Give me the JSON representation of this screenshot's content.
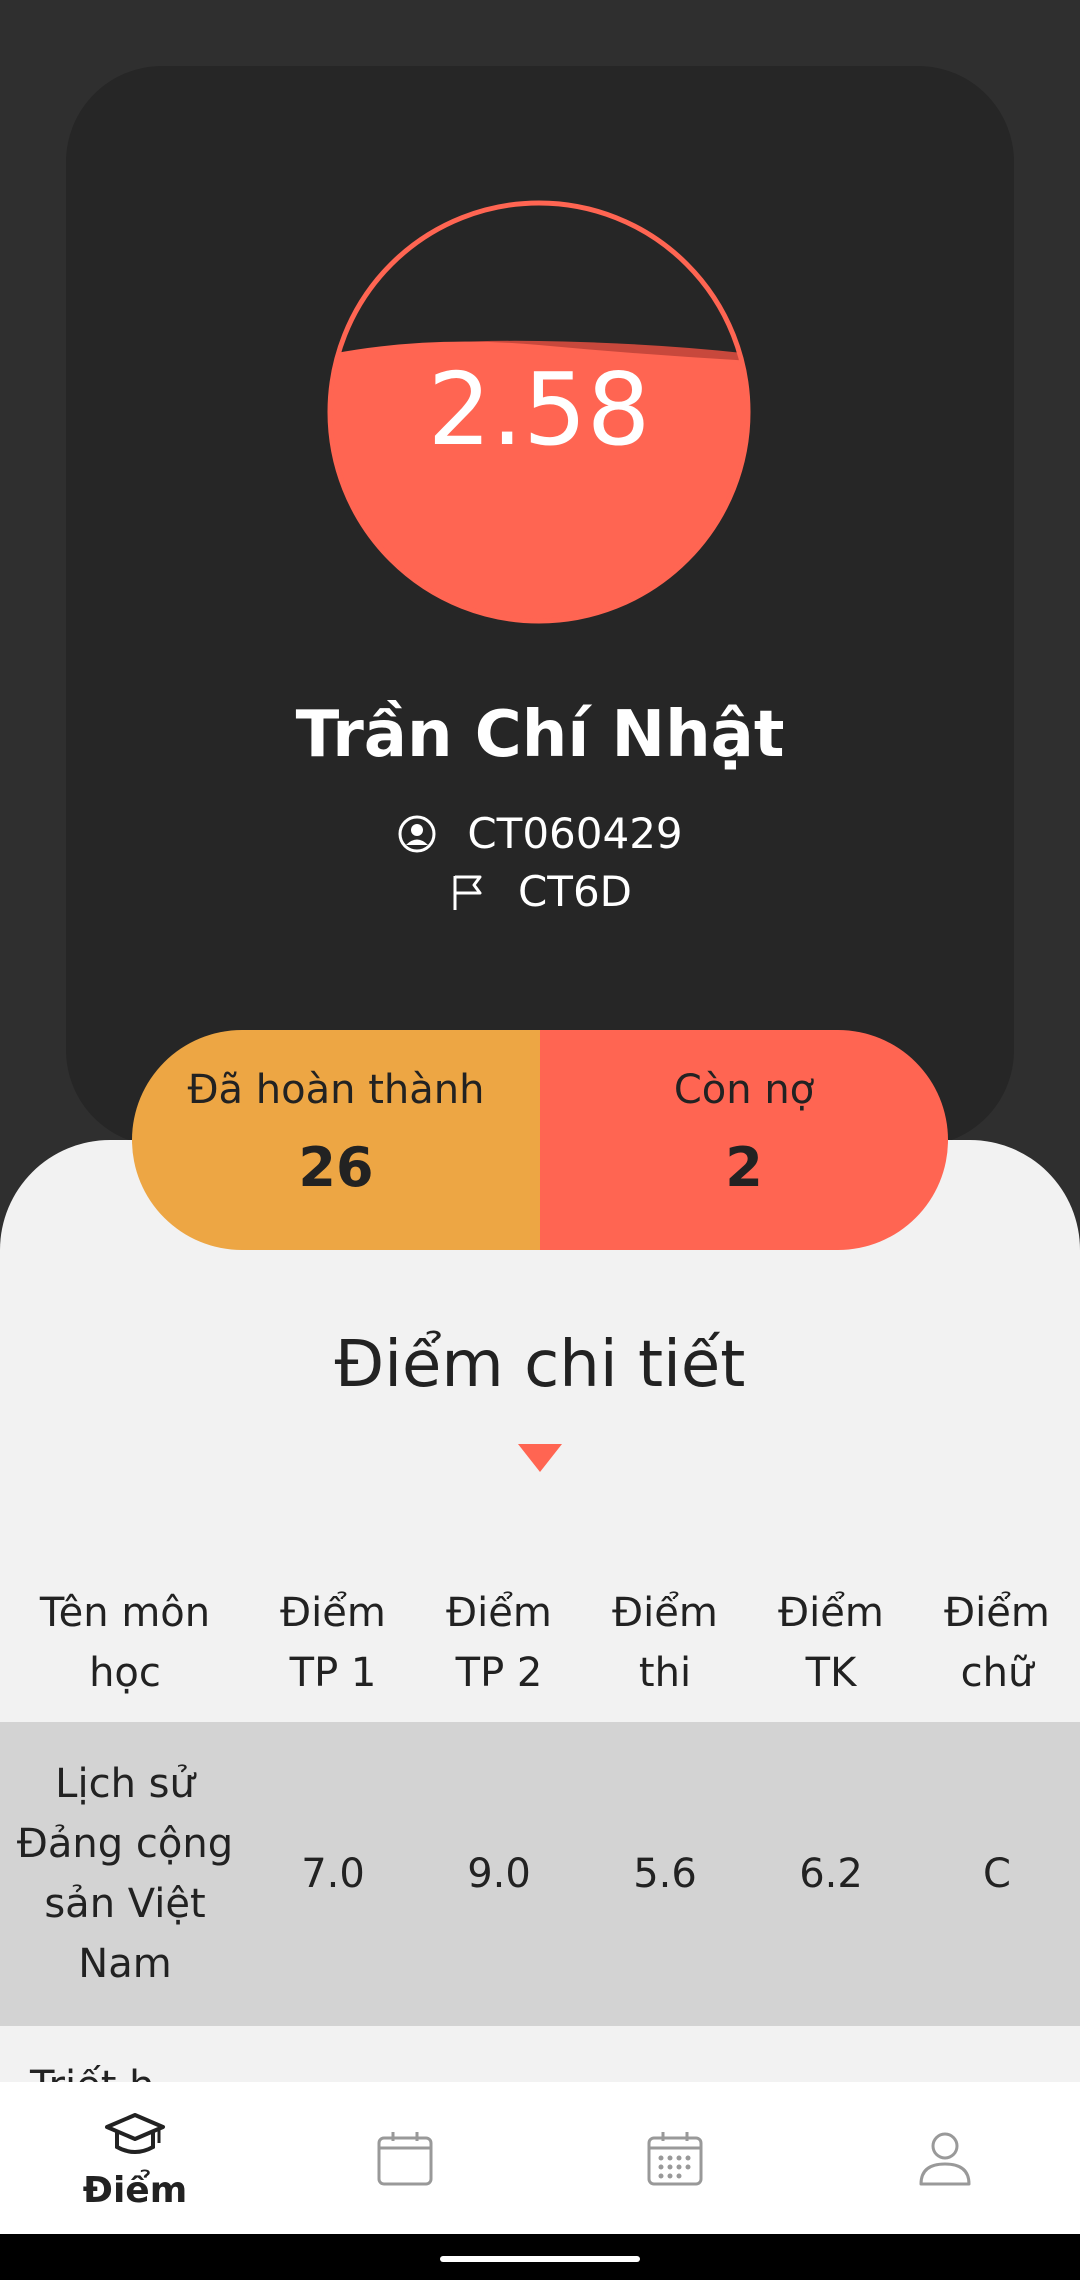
{
  "header": {
    "gpa": "2.58",
    "gpa_fill_percent": 65,
    "student_name": "Trần Chí Nhật",
    "student_id": "CT060429",
    "class_name": "CT6D"
  },
  "stats": {
    "completed_label": "Đã hoàn thành",
    "completed_value": "26",
    "debt_label": "Còn nợ",
    "debt_value": "2"
  },
  "section": {
    "title": "Điểm chi tiết"
  },
  "table": {
    "headers": [
      "Tên môn học",
      "Điểm TP 1",
      "Điểm TP 2",
      "Điểm thi",
      "Điểm TK",
      "Điểm chữ"
    ],
    "rows": [
      [
        "Lịch sử Đảng cộng sản Việt Nam",
        "7.0",
        "9.0",
        "5.6",
        "6.2",
        "C"
      ]
    ],
    "next_row_partial": "Triết h"
  },
  "nav": {
    "items": [
      {
        "label": "Điểm",
        "icon": "graduation-cap-icon",
        "active": true
      },
      {
        "label": "",
        "icon": "calendar-blank-icon",
        "active": false
      },
      {
        "label": "",
        "icon": "calendar-grid-icon",
        "active": false
      },
      {
        "label": "",
        "icon": "user-icon",
        "active": false
      }
    ]
  },
  "colors": {
    "accent_red": "#ff6552",
    "accent_orange": "#eda644",
    "dark_bg": "#262626",
    "sheet_bg": "#f2f2f2",
    "row_highlight": "#d3d3d3"
  }
}
